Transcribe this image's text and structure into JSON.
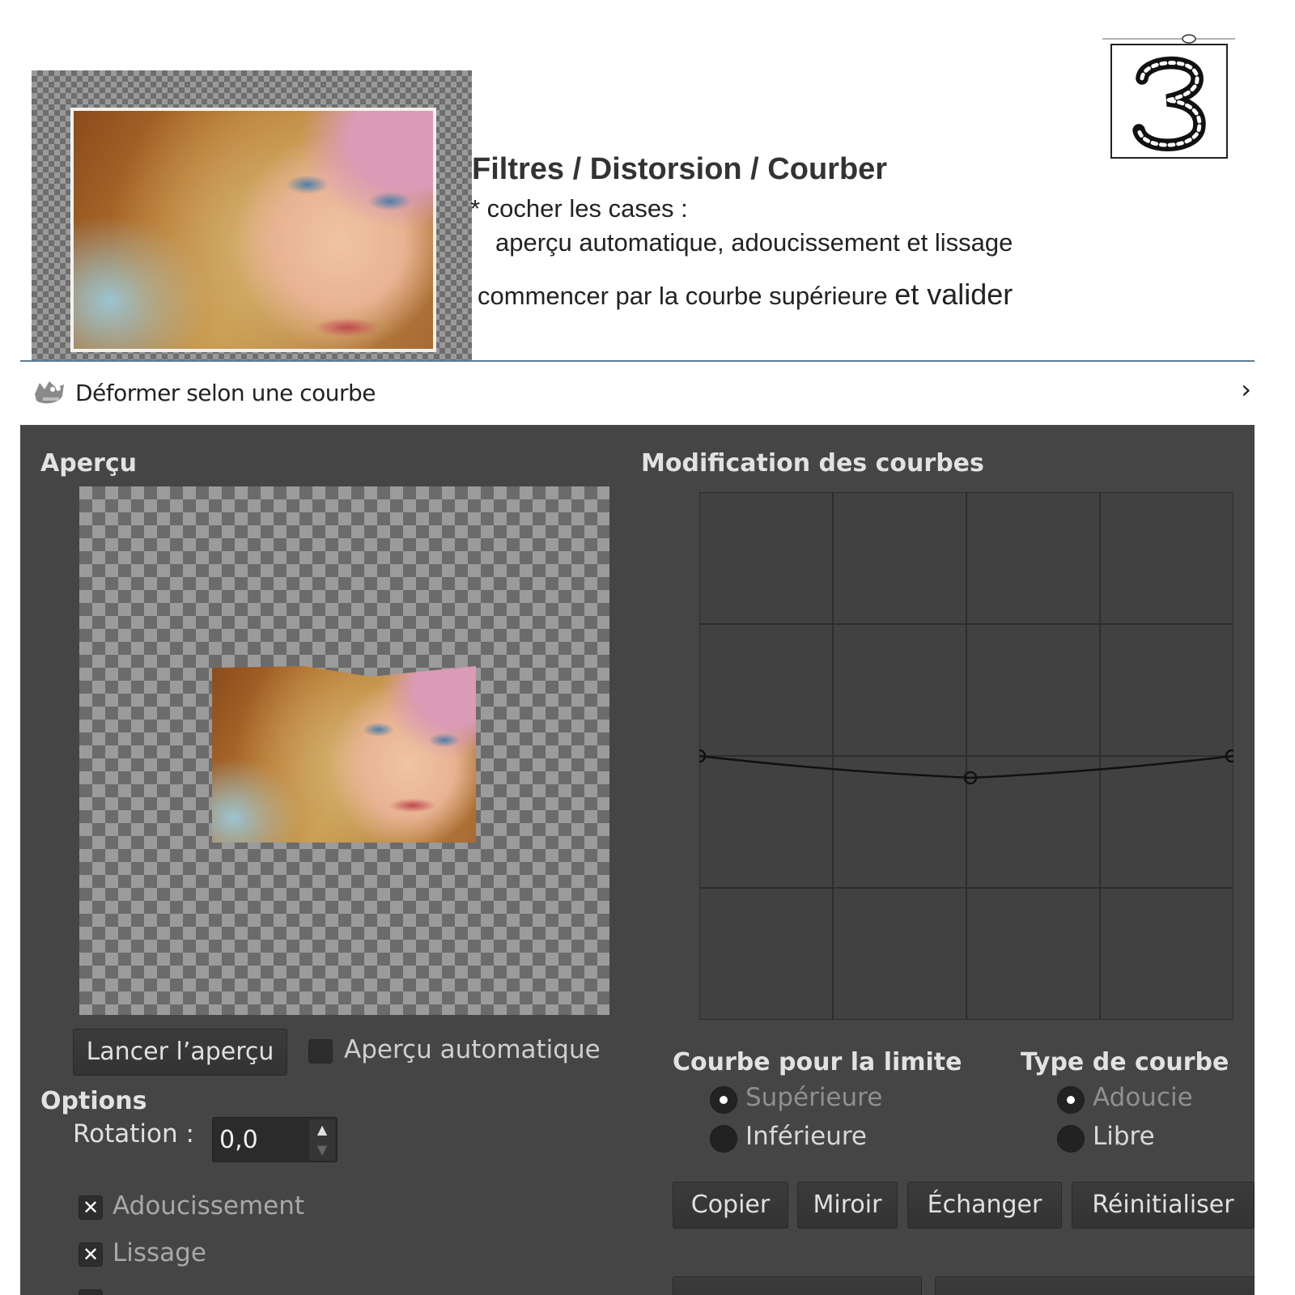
{
  "tutorial": {
    "menu_path": "Filtres / Distorsion / Courber",
    "instruction_line1": "* cocher les cases :",
    "instruction_line2": "aperçu automatique, adoucissement et lissage",
    "instruction_line3_prefix": "commencer par la courbe supérieure ",
    "instruction_line3_emphasis": "et valider",
    "step_number": "3"
  },
  "window": {
    "title": "Déformer selon une courbe",
    "chevron": "›"
  },
  "dialog": {
    "preview_section": "Aperçu",
    "preview_button": "Lancer l’aperçu",
    "auto_preview_label": "Aperçu automatique",
    "auto_preview_checked": false,
    "options_section": "Options",
    "rotation_label": "Rotation :",
    "rotation_value": "0,0",
    "antialias_label": "Adoucissement",
    "antialias_checked": true,
    "smoothing_label": "Lissage",
    "smoothing_checked": true,
    "curves_section": "Modification des courbes",
    "boundary_section": "Courbe pour la limite",
    "boundary_options": [
      {
        "label": "Supérieure",
        "checked": true
      },
      {
        "label": "Inférieure",
        "checked": false
      }
    ],
    "curve_type_section": "Type de courbe",
    "curve_type_options": [
      {
        "label": "Adoucie",
        "checked": true
      },
      {
        "label": "Libre",
        "checked": false
      }
    ],
    "buttons": {
      "copy": "Copier",
      "mirror": "Miroir",
      "swap": "Échanger",
      "reset": "Réinitialiser"
    }
  },
  "colors": {
    "dialog_bg": "#454545",
    "grid_line": "#2e2e2e",
    "curve": "#111111"
  }
}
